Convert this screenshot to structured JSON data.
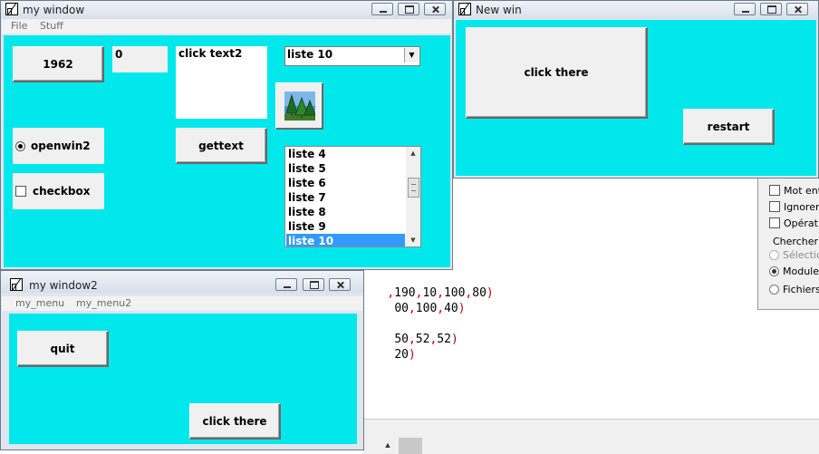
{
  "editor": {
    "code_lines": [
      {
        "nums": [
          "190",
          "10",
          "100",
          "80"
        ],
        "tail": ")"
      },
      {
        "nums": [
          "00",
          "100",
          "40"
        ],
        "tail": ")"
      },
      {
        "nums": [
          "50",
          "52",
          "52"
        ],
        "tail": ")"
      },
      {
        "nums": [
          "20"
        ],
        "tail": ")"
      }
    ],
    "search_panel": {
      "checkboxes": [
        "Mot entie",
        "Ignorer le",
        "Opératio"
      ],
      "section_label": "Chercher c",
      "radios": [
        {
          "label": "Sélectio",
          "state": "disabled"
        },
        {
          "label": "Module",
          "state": "selected"
        },
        {
          "label": "Fichiers",
          "state": "off"
        }
      ]
    }
  },
  "window1": {
    "title": "my window",
    "menu": [
      "File",
      "Stuff"
    ],
    "year_button": "1962",
    "counter_value": "0",
    "text_area": "click text2",
    "gettext_button": "gettext",
    "radio_label": "openwin2",
    "radio_checked": true,
    "checkbox_label": "checkbox",
    "checkbox_checked": false,
    "combo_value": "liste 10",
    "image_button_icon": "forest-icon",
    "list_items": [
      "liste 4",
      "liste 5",
      "liste 6",
      "liste 7",
      "liste 8",
      "liste 9",
      "liste 10"
    ],
    "list_selected": "liste 10"
  },
  "window_new": {
    "title": "New win",
    "click_button": "click there",
    "restart_button": "restart"
  },
  "window2": {
    "title": "my window2",
    "menu": [
      "my_menu",
      "my_menu2"
    ],
    "quit_button": "quit",
    "click_button": "click there"
  },
  "colors": {
    "client_bg": "#00e8ec",
    "button_face": "#f0f0f0",
    "list_highlight": "#3399ff"
  }
}
